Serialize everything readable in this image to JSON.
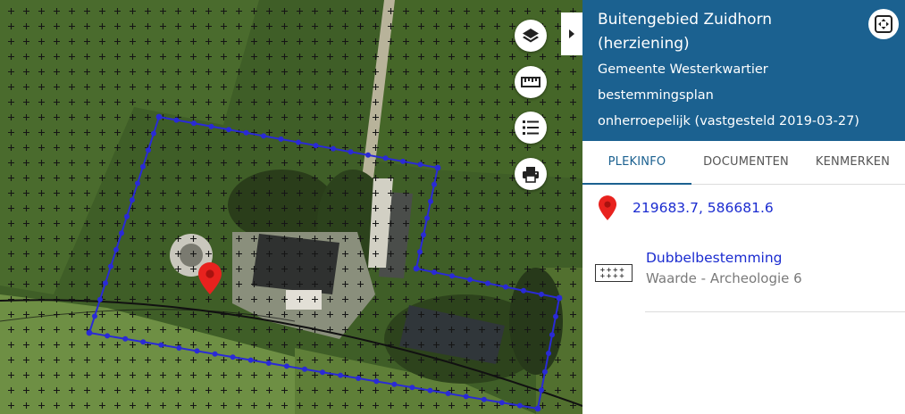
{
  "map": {
    "controls": [
      {
        "name": "layers-button",
        "icon": "layers-icon"
      },
      {
        "name": "measure-button",
        "icon": "ruler-icon"
      },
      {
        "name": "legend-button",
        "icon": "list-icon"
      },
      {
        "name": "print-button",
        "icon": "printer-icon"
      }
    ],
    "marker_icon": "map-marker-icon",
    "panel_toggle_icon": "caret-right-icon",
    "colors": {
      "plan_boundary": "#2a2ad6",
      "marker": "#e8221e",
      "grid_cross": "#1a1a1a"
    }
  },
  "panel": {
    "header": {
      "title": "Buitengebied Zuidhorn (herziening)",
      "gemeente": "Gemeente Westerkwartier",
      "type": "bestemmingsplan",
      "status": "onherroepelijk (vastgesteld 2019-03-27)",
      "fullscreen_icon": "fullscreen-icon",
      "background": "#1b6190"
    },
    "tabs": [
      {
        "label": "PLEKINFO",
        "active": true
      },
      {
        "label": "DOCUMENTEN",
        "active": false
      },
      {
        "label": "KENMERKEN",
        "active": false
      }
    ],
    "location": {
      "icon": "map-marker-icon",
      "coordinates": "219683.7, 586681.6"
    },
    "bestemming": {
      "icon": "dubbelbestemming-pattern-icon",
      "name": "Dubbelbestemming",
      "subtitle": "Waarde - Archeologie 6"
    }
  }
}
